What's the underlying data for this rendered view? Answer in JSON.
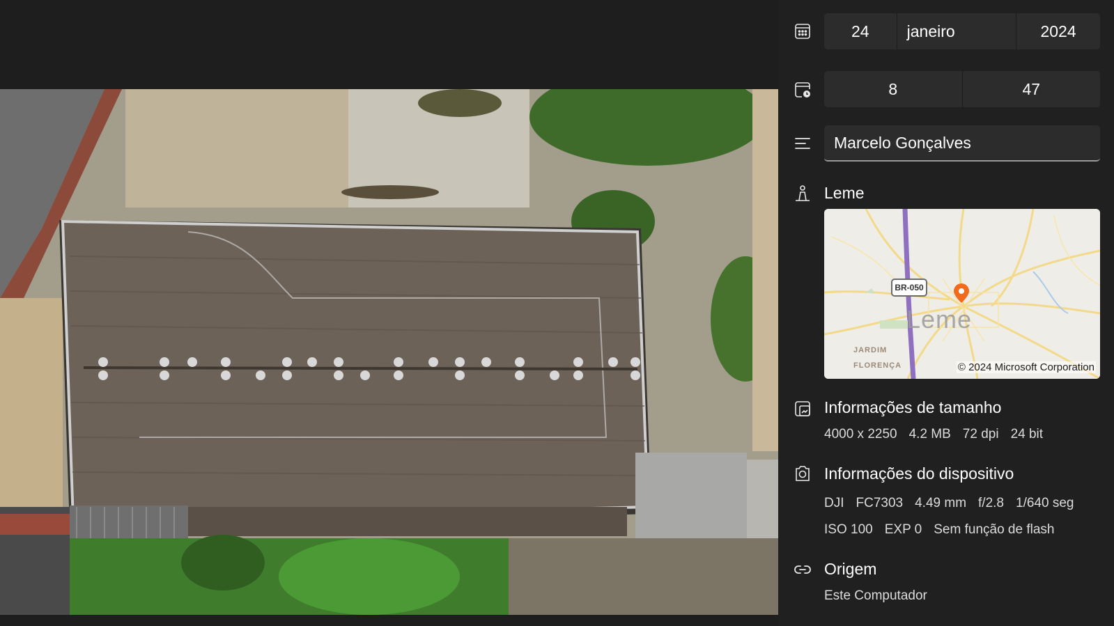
{
  "date": {
    "day": "24",
    "month": "janeiro",
    "year": "2024"
  },
  "time": {
    "hour": "8",
    "minute": "47"
  },
  "author": {
    "value": "Marcelo Gonçalves"
  },
  "location": {
    "name": "Leme",
    "map": {
      "road_label": "BR-050",
      "city_label": "Leme",
      "district_line1": "JARDIM",
      "district_line2": "FLORENÇA",
      "copyright": "© 2024 Microsoft Corporation"
    }
  },
  "size_info": {
    "title": "Informações de tamanho",
    "dimensions": "4000 x 2250",
    "file_size": "4.2 MB",
    "dpi": "72 dpi",
    "bit_depth": "24 bit"
  },
  "device_info": {
    "title": "Informações do dispositivo",
    "make": "DJI",
    "model": "FC7303",
    "focal_length": "4.49 mm",
    "aperture": "f/2.8",
    "shutter": "1/640 seg",
    "iso": "ISO 100",
    "exposure": "EXP 0",
    "flash": "Sem função de flash"
  },
  "origin": {
    "title": "Origem",
    "value": "Este Computador"
  },
  "icons": {
    "date": "calendar-icon",
    "time": "clock-calendar-icon",
    "author": "text-lines-icon",
    "location": "location-person-icon",
    "size": "image-size-icon",
    "device": "camera-icon",
    "origin": "link-icon"
  },
  "colors": {
    "panel_bg": "#202020",
    "field_bg": "#2c2c2c",
    "pin": "#f26a1b"
  }
}
